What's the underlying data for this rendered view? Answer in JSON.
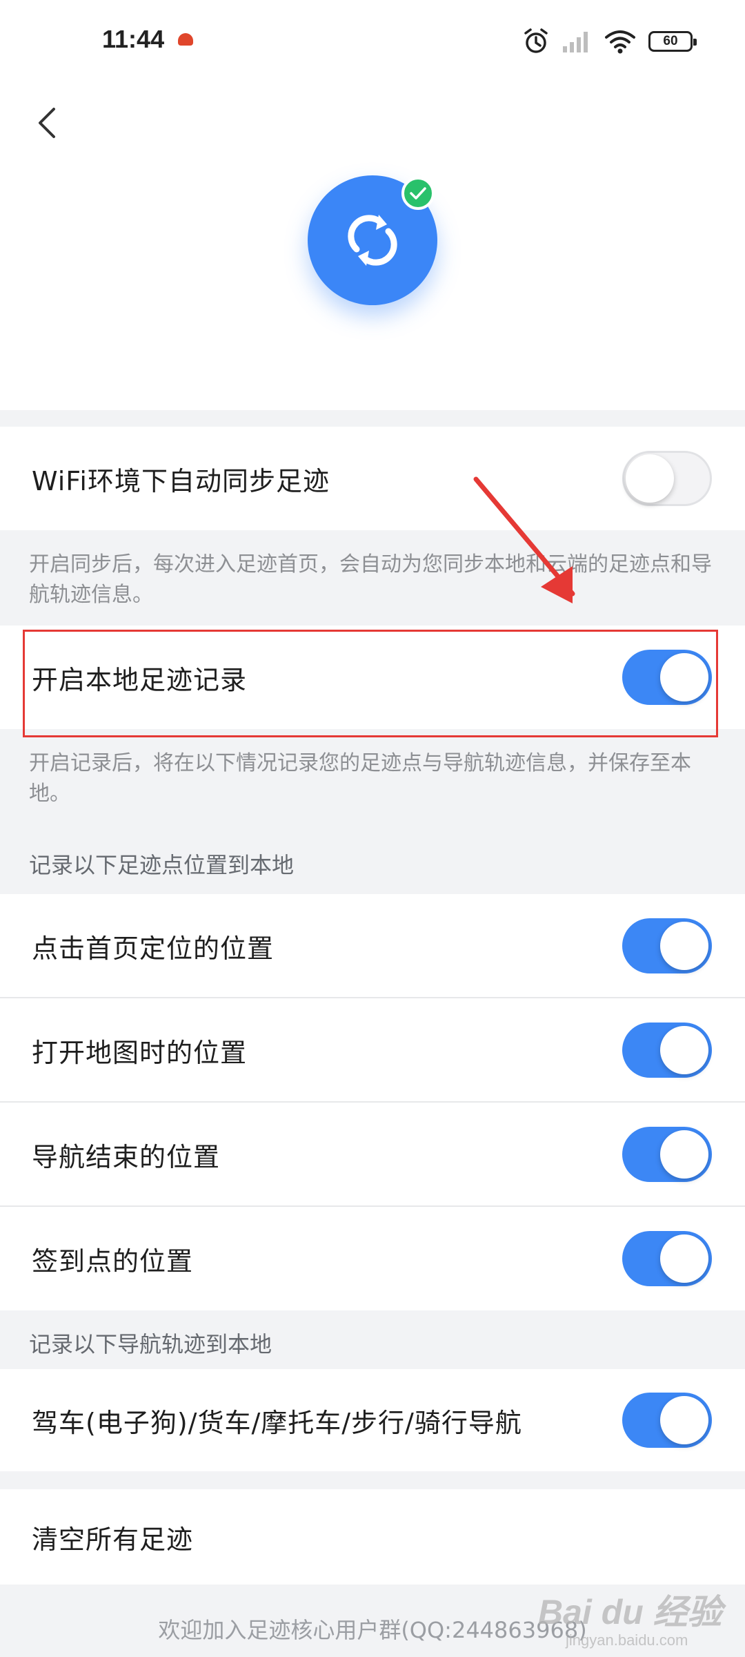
{
  "status_bar": {
    "time": "11:44",
    "battery": "60",
    "icons": [
      "notification-icon",
      "alarm-icon",
      "signal-icon",
      "wifi-icon",
      "battery-icon"
    ]
  },
  "header": {
    "back_icon": "chevron-left-icon",
    "logo_icon": "sync-icon",
    "badge_icon": "check-icon"
  },
  "wifi_sync": {
    "label": "WiFi环境下自动同步足迹",
    "enabled": false,
    "note": "开启同步后，每次进入足迹首页，会自动为您同步本地和云端的足迹点和导航轨迹信息。"
  },
  "local_record": {
    "label": "开启本地足迹记录",
    "enabled": true,
    "note": "开启记录后，将在以下情况记录您的足迹点与导航轨迹信息，并保存至本地。"
  },
  "points_section": {
    "title": "记录以下足迹点位置到本地",
    "items": [
      {
        "label": "点击首页定位的位置",
        "enabled": true
      },
      {
        "label": "打开地图时的位置",
        "enabled": true
      },
      {
        "label": "导航结束的位置",
        "enabled": true
      },
      {
        "label": "签到点的位置",
        "enabled": true
      }
    ]
  },
  "tracks_section": {
    "title": "记录以下导航轨迹到本地",
    "items": [
      {
        "label": "驾车(电子狗)/货车/摩托车/步行/骑行导航",
        "enabled": true
      }
    ]
  },
  "clear_all": {
    "label": "清空所有足迹"
  },
  "footer": {
    "text": "欢迎加入足迹核心用户群(QQ:244863968)"
  },
  "watermark": {
    "main": "Bai du 经验",
    "sub": "jingyan.baidu.com"
  },
  "colors": {
    "accent": "#3c87f5",
    "badge": "#29c16b",
    "annotation": "#e53935",
    "background": "#f2f3f5"
  }
}
